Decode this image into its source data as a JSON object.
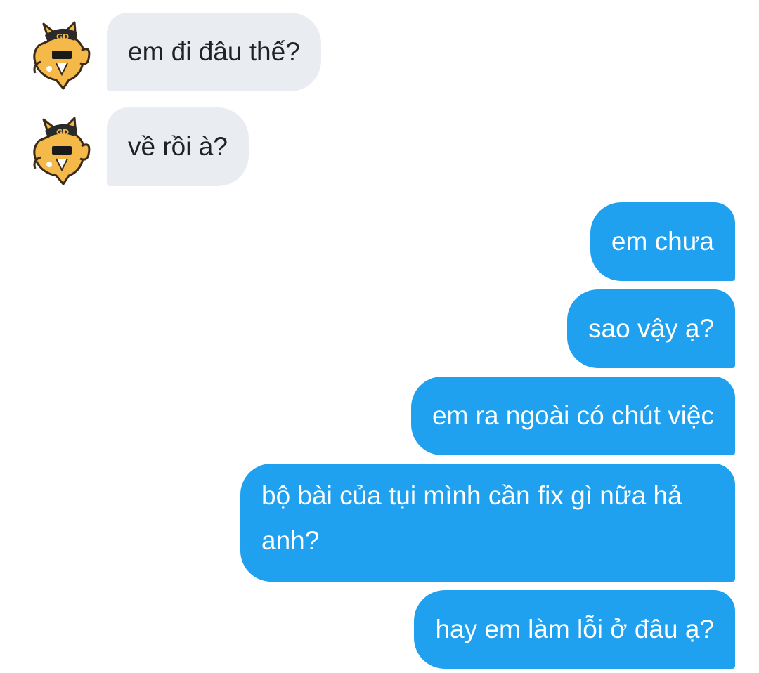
{
  "messages": [
    {
      "direction": "incoming",
      "text": "em đi đâu thế?"
    },
    {
      "direction": "incoming",
      "text": "về rồi à?"
    },
    {
      "direction": "outgoing",
      "text": "em chưa"
    },
    {
      "direction": "outgoing",
      "text": "sao vậy ạ?"
    },
    {
      "direction": "outgoing",
      "text": "em ra ngoài có chút việc"
    },
    {
      "direction": "outgoing",
      "text": "bộ bài của tụi mình cần fix gì nữa hả anh?"
    },
    {
      "direction": "outgoing",
      "text": "hay em làm lỗi ở đâu ạ?"
    }
  ],
  "avatar": {
    "icon": "cat-sticker-avatar-icon",
    "badge_text": "GD"
  },
  "colors": {
    "incoming_bubble": "#e9edf1",
    "incoming_text": "#1f2226",
    "outgoing_bubble": "#1fa1f0",
    "outgoing_text": "#ffffff",
    "avatar_fur": "#f5b94a"
  }
}
